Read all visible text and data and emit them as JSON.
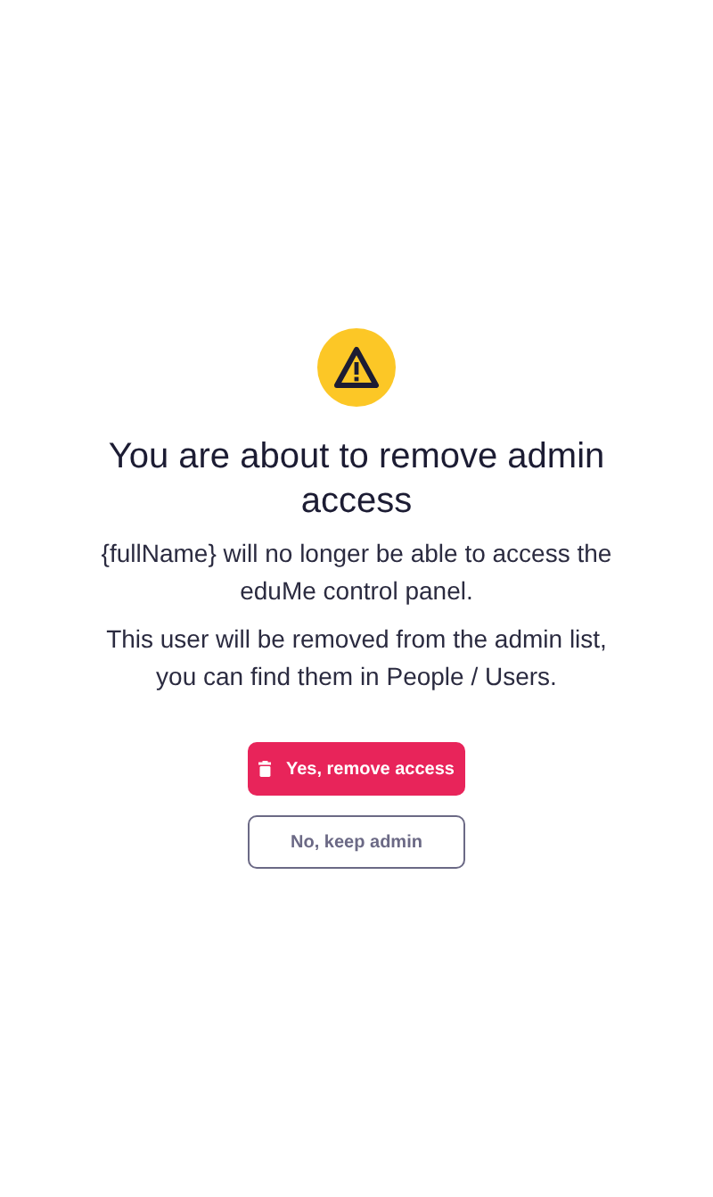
{
  "dialog": {
    "title": "You are about to remove admin access",
    "paragraphs": [
      "{fullName} will no longer be able to access the eduMe control panel.",
      "This user will be removed from the admin list, you can find them in People / Users."
    ],
    "buttons": [
      {
        "label": "Yes, remove access",
        "kind": "danger"
      },
      {
        "label": "No, keep admin",
        "kind": "outline"
      }
    ]
  }
}
